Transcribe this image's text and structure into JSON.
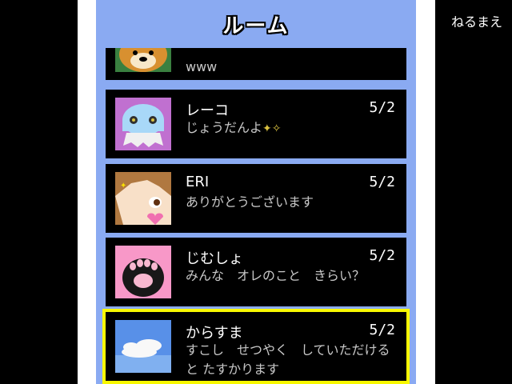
{
  "corner_label": "ねるまえ",
  "title": "ルーム",
  "rooms": [
    {
      "name": "",
      "date": "",
      "message": "www",
      "avatar": "dog-avatar"
    },
    {
      "name": "レーコ",
      "date": "5/2",
      "message": "じょうだんよ",
      "avatar": "ghost-avatar",
      "emoji": "sparkle-icon"
    },
    {
      "name": "ERI",
      "date": "5/2",
      "message": "ありがとうございます",
      "avatar": "girl-avatar"
    },
    {
      "name": "じむしょ",
      "date": "5/2",
      "message": "みんな　オレのこと　きらい？",
      "avatar": "paw-avatar"
    },
    {
      "name": "からすま",
      "date": "5/2",
      "message": "すこし　せつやく　していただけると たすかります",
      "avatar": "cloud-avatar"
    }
  ]
}
